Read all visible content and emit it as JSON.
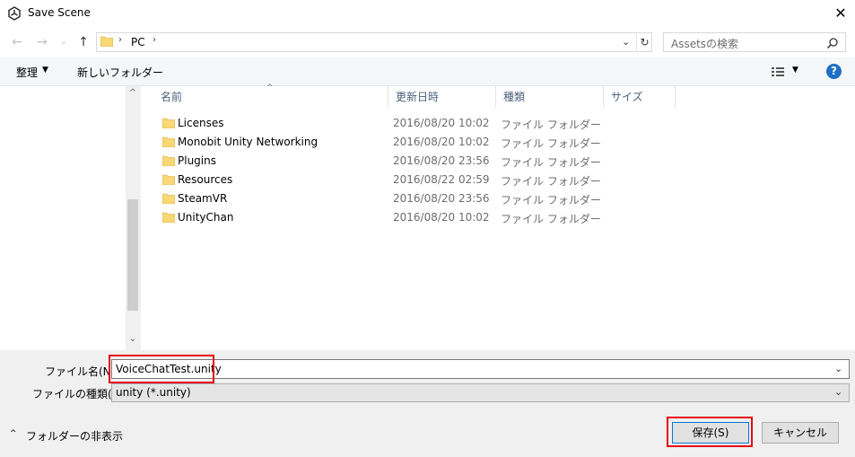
{
  "window": {
    "title": "Save Scene",
    "close_symbol": "✕"
  },
  "nav": {
    "back_symbol": "←",
    "forward_symbol": "→",
    "recent_symbol": "⌄",
    "up_symbol": "↑",
    "address_sep": "›",
    "address_text": "PC",
    "address_dropdown": "⌄",
    "refresh_symbol": "↻",
    "search_placeholder": "Assetsの検索"
  },
  "toolbar": {
    "organize_label": "整理",
    "organize_caret": "▼",
    "new_folder_label": "新しいフォルダー",
    "view_caret": "▼",
    "help_label": "?"
  },
  "columns": {
    "name": "名前",
    "date": "更新日時",
    "type": "種類",
    "size": "サイズ",
    "sort_arrow": "^"
  },
  "scrollbar": {
    "up": "^",
    "down": "⌄"
  },
  "files": [
    {
      "name": "Licenses",
      "date": "2016/08/20 10:02",
      "type": "ファイル フォルダー"
    },
    {
      "name": "Monobit Unity Networking",
      "date": "2016/08/20 10:02",
      "type": "ファイル フォルダー"
    },
    {
      "name": "Plugins",
      "date": "2016/08/20 23:56",
      "type": "ファイル フォルダー"
    },
    {
      "name": "Resources",
      "date": "2016/08/22 02:59",
      "type": "ファイル フォルダー"
    },
    {
      "name": "SteamVR",
      "date": "2016/08/20 23:56",
      "type": "ファイル フォルダー"
    },
    {
      "name": "UnityChan",
      "date": "2016/08/20 10:02",
      "type": "ファイル フォルダー"
    }
  ],
  "form": {
    "filename_label": "ファイル名(N):",
    "filename_value": "VoiceChatTest.unity",
    "filetype_label": "ファイルの種類(T):",
    "filetype_value": "unity (*.unity)",
    "dropdown_symbol": "⌄",
    "hide_folders_caret": "^",
    "hide_folders_label": "フォルダーの非表示",
    "save_label": "保存(S)",
    "cancel_label": "キャンセル"
  },
  "colors": {
    "highlight": "#e8000e",
    "help": "#1e6fc6",
    "folder": "#f8d775"
  }
}
